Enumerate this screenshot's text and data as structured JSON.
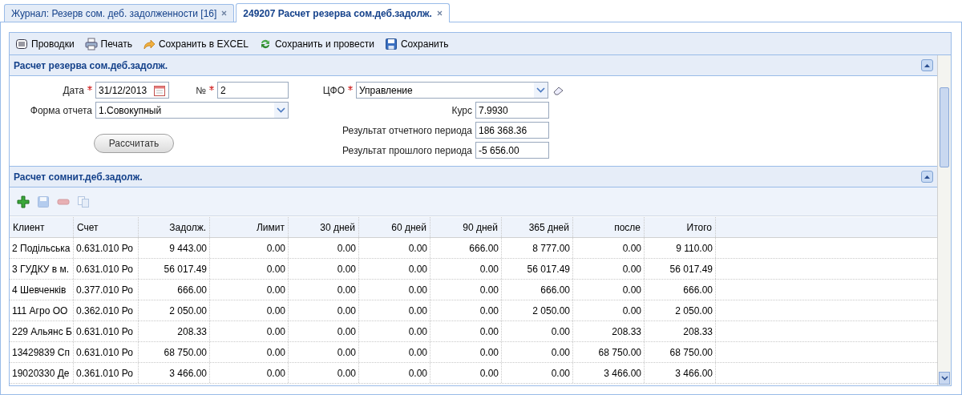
{
  "tabs": [
    {
      "label": "Журнал: Резерв сом. деб. задолженности [16]",
      "selected": false
    },
    {
      "label": "249207 Расчет резерва сом.деб.задолж.",
      "selected": true
    }
  ],
  "toolbar": [
    {
      "kind": "list",
      "label": "Проводки"
    },
    {
      "kind": "print",
      "label": "Печать"
    },
    {
      "kind": "export",
      "label": "Сохранить в EXCEL"
    },
    {
      "kind": "refresh",
      "label": "Сохранить и провести"
    },
    {
      "kind": "save",
      "label": "Сохранить"
    }
  ],
  "form_panel": {
    "title": "Расчет резерва сом.деб.задолж.",
    "date": {
      "label": "Дата",
      "required": true,
      "value": "31/12/2013"
    },
    "number": {
      "label": "№",
      "required": true,
      "value": "2"
    },
    "report_form": {
      "label": "Форма отчета",
      "required": false,
      "value": "1.Совокупный"
    },
    "cfo": {
      "label": "ЦФО",
      "required": true,
      "value": "Управление"
    },
    "rate": {
      "label": "Курс",
      "value": "7.9930"
    },
    "result_current": {
      "label": "Результат отчетного периода",
      "value": "186 368.36"
    },
    "result_previous": {
      "label": "Результат прошлого периода",
      "value": "-5 656.00"
    },
    "calc_button": "Рассчитать"
  },
  "grid_panel": {
    "title": "Расчет сомнит.деб.задолж.",
    "tools": [
      {
        "kind": "add",
        "disabled": false
      },
      {
        "kind": "save",
        "disabled": true
      },
      {
        "kind": "remove",
        "disabled": true
      },
      {
        "kind": "copy",
        "disabled": true
      }
    ],
    "columns": [
      "Клиент",
      "Счет",
      "Задолж.",
      "Лимит",
      "30 дней",
      "60 дней",
      "90 дней",
      "365 дней",
      "после",
      "Итого"
    ],
    "rows": [
      [
        "2 Подільська",
        "0.631.010 Ро",
        "9 443.00",
        "0.00",
        "0.00",
        "0.00",
        "666.00",
        "8 777.00",
        "0.00",
        "9 110.00"
      ],
      [
        "3 ГУДКУ в м.",
        "0.631.010 Ро",
        "56 017.49",
        "0.00",
        "0.00",
        "0.00",
        "0.00",
        "56 017.49",
        "0.00",
        "56 017.49"
      ],
      [
        "4 Шевченків",
        "0.377.010 Ро",
        "666.00",
        "0.00",
        "0.00",
        "0.00",
        "0.00",
        "666.00",
        "0.00",
        "666.00"
      ],
      [
        "111 Агро ОО",
        "0.362.010 Ро",
        "2 050.00",
        "0.00",
        "0.00",
        "0.00",
        "0.00",
        "2 050.00",
        "0.00",
        "2 050.00"
      ],
      [
        "229 Альянс Б",
        "0.631.010 Ро",
        "208.33",
        "0.00",
        "0.00",
        "0.00",
        "0.00",
        "0.00",
        "208.33",
        "208.33"
      ],
      [
        "13429839 Сп",
        "0.631.010 Ро",
        "68 750.00",
        "0.00",
        "0.00",
        "0.00",
        "0.00",
        "0.00",
        "68 750.00",
        "68 750.00"
      ],
      [
        "19020330 Де",
        "0.361.010 Ро",
        "3 466.00",
        "0.00",
        "0.00",
        "0.00",
        "0.00",
        "0.00",
        "3 466.00",
        "3 466.00"
      ]
    ]
  }
}
